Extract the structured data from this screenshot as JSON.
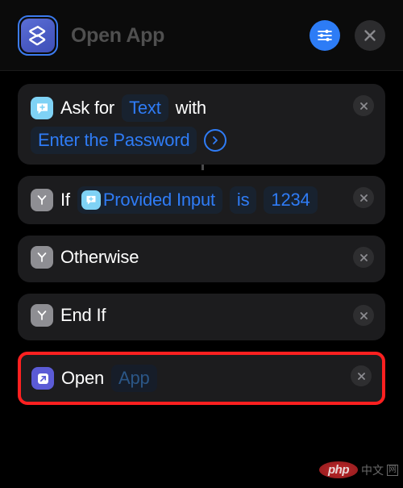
{
  "header": {
    "app_icon_name": "shortcuts-app-icon",
    "title": "Open App",
    "settings_button_label": "Settings",
    "close_button_label": "Close",
    "accent_blue": "#2d7cf6",
    "icon_gradient_start": "#5b6fd6",
    "icon_gradient_end": "#3f50b8"
  },
  "actions": [
    {
      "id": "ask-for-input",
      "glyph": "speech-bubble-plus-icon",
      "glyph_color": "#7fd2f5",
      "tokens": [
        {
          "kind": "text",
          "value": "Ask for"
        },
        {
          "kind": "pill",
          "value": "Text"
        },
        {
          "kind": "text",
          "value": "with"
        },
        {
          "kind": "pill",
          "value": "Enter the Password"
        },
        {
          "kind": "chevron",
          "value": "chevron-right-icon"
        }
      ],
      "remove_label": "Remove action"
    },
    {
      "id": "if-condition",
      "glyph": "branch-y-icon",
      "glyph_color": "#8e8e93",
      "tokens": [
        {
          "kind": "text",
          "value": "If"
        },
        {
          "kind": "pill-var",
          "value": "Provided Input",
          "var_glyph": "speech-bubble-plus-icon"
        },
        {
          "kind": "pill",
          "value": "is"
        },
        {
          "kind": "pill",
          "value": "1234"
        }
      ],
      "remove_label": "Remove action"
    },
    {
      "id": "otherwise",
      "glyph": "branch-y-icon",
      "glyph_color": "#8e8e93",
      "tokens": [
        {
          "kind": "text",
          "value": "Otherwise"
        }
      ],
      "remove_label": "Remove action"
    },
    {
      "id": "end-if",
      "glyph": "branch-y-icon",
      "glyph_color": "#8e8e93",
      "tokens": [
        {
          "kind": "text",
          "value": "End If"
        }
      ],
      "remove_label": "Remove action"
    },
    {
      "id": "open-app",
      "glyph": "arrow-up-right-box-icon",
      "glyph_color": "#5b5bd6",
      "highlighted": true,
      "highlight_color": "#ff2020",
      "tokens": [
        {
          "kind": "text",
          "value": "Open"
        },
        {
          "kind": "pill-muted",
          "value": "App"
        }
      ],
      "remove_label": "Remove action"
    }
  ],
  "watermark": {
    "logo_text": "php",
    "cn_text": "中文",
    "box_text": "网"
  }
}
